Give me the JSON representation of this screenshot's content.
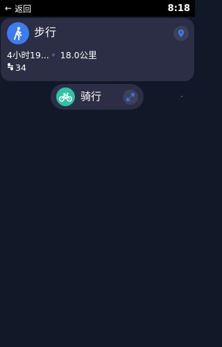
{
  "status_bar": {
    "back_label": "返回",
    "time": "8:18"
  },
  "walk_card": {
    "title": "步行",
    "duration": "4小时19...",
    "distance": "18.0公里",
    "steps": "34",
    "icons": {
      "mode": "walking-person-icon",
      "location": "location-pin-icon",
      "steps": "steps-icon"
    }
  },
  "bike_pill": {
    "title": "骑行",
    "icons": {
      "mode": "bicycle-icon",
      "expand": "expand-arrows-icon"
    }
  },
  "colors": {
    "background": "#111827",
    "card": "#2b2e45",
    "walk_accent": "#3d7cf0",
    "bike_accent": "#2dc4a4"
  }
}
